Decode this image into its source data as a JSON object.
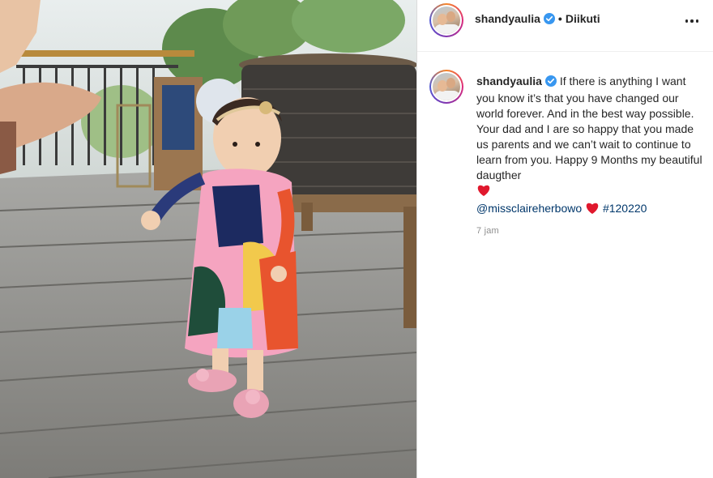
{
  "post": {
    "author": {
      "username": "shandyaulia",
      "verified": true,
      "follow_status": "Diikuti",
      "separator": "•"
    },
    "caption": {
      "text": "If there is anything I want you know it’s that you have changed our world forever. And in the best way possible. Your dad and I are so happy that you made us parents and we can’t wait to continue to learn from you. Happy 9 Months my beautiful daugther",
      "mention": "@missclaireherbowo",
      "hashtag": "#120220"
    },
    "timestamp": "7 jam"
  },
  "icons": {
    "verified": "verified-badge-icon",
    "more": "more-options-icon",
    "heart": "red-heart-emoji-icon"
  },
  "colors": {
    "verified_blue": "#3897f0",
    "link_blue": "#00376b",
    "heart_red": "#e0182d",
    "muted_text": "#8e8e8e"
  }
}
